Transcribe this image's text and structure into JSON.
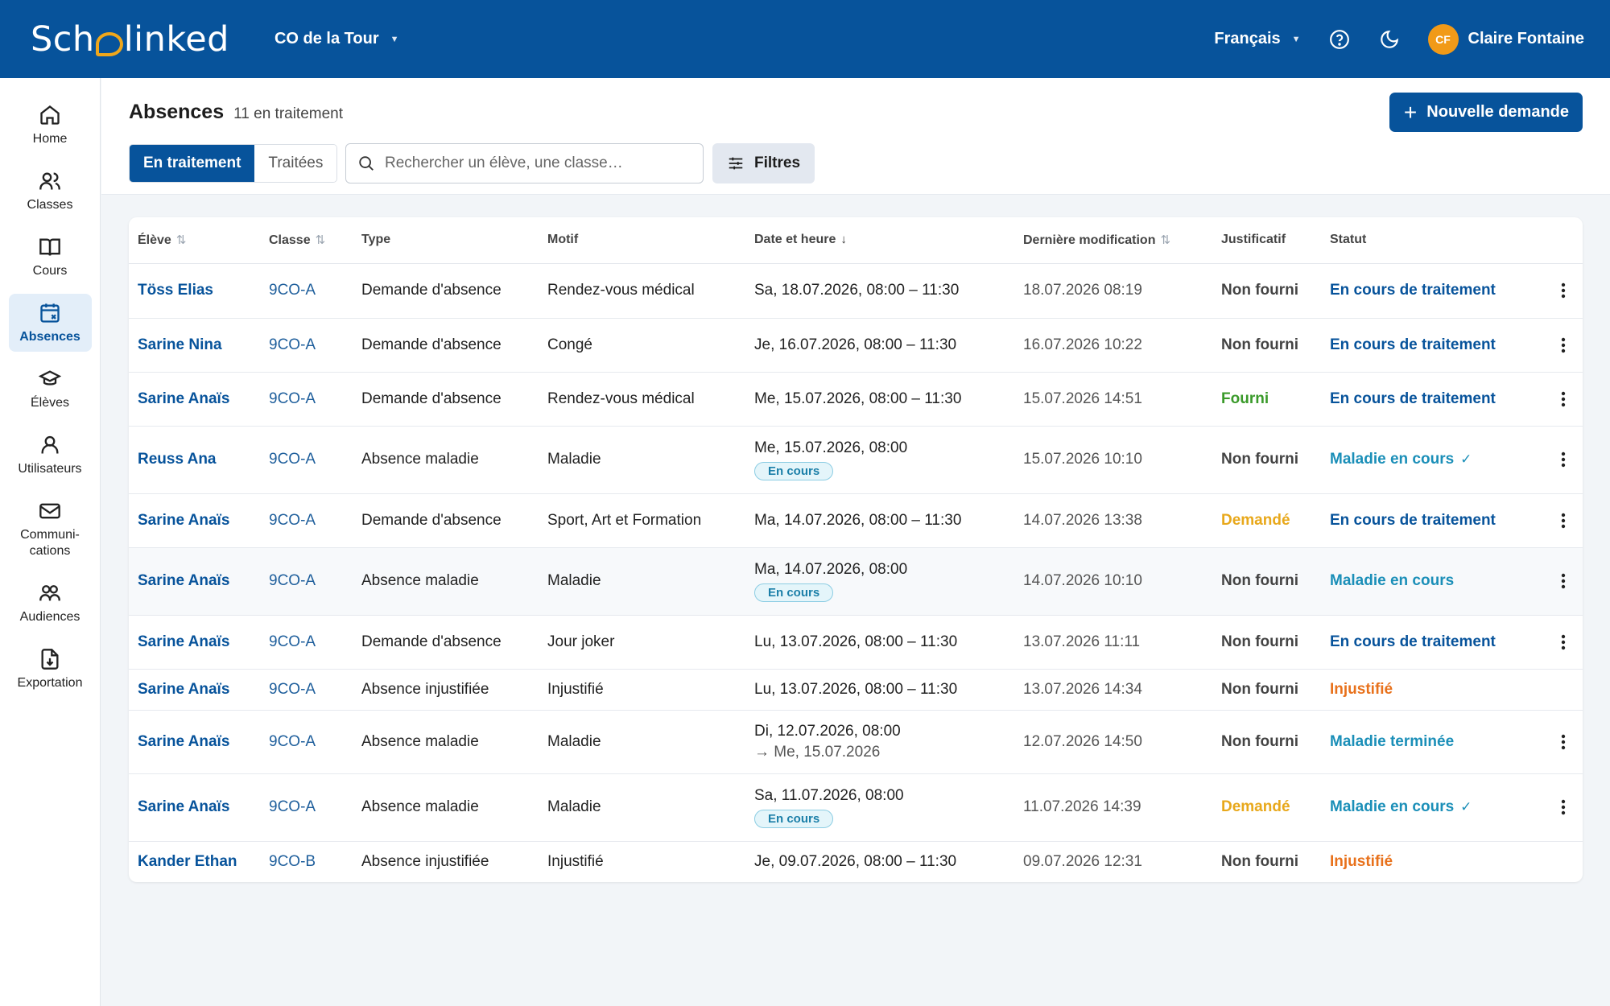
{
  "app": {
    "logo_text_a": "Sch",
    "logo_text_b": "linked",
    "school": "CO de la Tour",
    "language": "Français",
    "user_initials": "CF",
    "user_name": "Claire Fontaine"
  },
  "sidebar": {
    "items": [
      {
        "label": "Home",
        "icon": "home-icon"
      },
      {
        "label": "Classes",
        "icon": "users-icon"
      },
      {
        "label": "Cours",
        "icon": "book-icon"
      },
      {
        "label": "Absences",
        "icon": "calendar-x-icon",
        "active": true
      },
      {
        "label": "Élèves",
        "icon": "graduation-cap-icon"
      },
      {
        "label": "Utilisateurs",
        "icon": "user-icon"
      },
      {
        "label": "Communi-\ncations",
        "icon": "mail-icon"
      },
      {
        "label": "Audiences",
        "icon": "audience-icon"
      },
      {
        "label": "Exportation",
        "icon": "export-icon"
      }
    ]
  },
  "header": {
    "title": "Absences",
    "count": "11 en traitement",
    "new_button": "Nouvelle demande",
    "tabs": [
      "En traitement",
      "Traitées"
    ],
    "search_placeholder": "Rechercher un élève, une classe…",
    "filters": "Filtres"
  },
  "table": {
    "columns": [
      "Élève",
      "Classe",
      "Type",
      "Motif",
      "Date et heure",
      "Dernière modification",
      "Justificatif",
      "Statut"
    ],
    "rows": [
      {
        "eleve": "Töss Elias",
        "classe": "9CO-A",
        "type": "Demande d'absence",
        "motif": "Rendez-vous médical",
        "date": "Sa, 18.07.2026, 08:00 – 11:30",
        "modif": "18.07.2026 08:19",
        "justificatif": "Non fourni",
        "statut": "En cours de traitement"
      },
      {
        "eleve": "Sarine Nina",
        "classe": "9CO-A",
        "type": "Demande d'absence",
        "motif": "Congé",
        "date": "Je, 16.07.2026, 08:00 – 11:30",
        "modif": "16.07.2026 10:22",
        "justificatif": "Non fourni",
        "statut": "En cours de traitement"
      },
      {
        "eleve": "Sarine Anaïs",
        "classe": "9CO-A",
        "type": "Demande d'absence",
        "motif": "Rendez-vous médical",
        "date": "Me, 15.07.2026, 08:00 – 11:30",
        "modif": "15.07.2026 14:51",
        "justificatif": "Fourni",
        "statut": "En cours de traitement"
      },
      {
        "eleve": "Reuss Ana",
        "classe": "9CO-A",
        "type": "Absence maladie",
        "motif": "Maladie",
        "date": "Me, 15.07.2026, 08:00",
        "badge": "En cours",
        "modif": "15.07.2026 10:10",
        "justificatif": "Non fourni",
        "statut": "Maladie en cours",
        "check": "✓"
      },
      {
        "eleve": "Sarine Anaïs",
        "classe": "9CO-A",
        "type": "Demande d'absence",
        "motif": "Sport, Art et Formation",
        "date": "Ma, 14.07.2026, 08:00 – 11:30",
        "modif": "14.07.2026 13:38",
        "justificatif": "Demandé",
        "statut": "En cours de traitement"
      },
      {
        "eleve": "Sarine Anaïs",
        "classe": "9CO-A",
        "type": "Absence maladie",
        "motif": "Maladie",
        "date": "Ma, 14.07.2026, 08:00",
        "badge": "En cours",
        "modif": "14.07.2026 10:10",
        "justificatif": "Non fourni",
        "statut": "Maladie en cours",
        "alt": true
      },
      {
        "eleve": "Sarine Anaïs",
        "classe": "9CO-A",
        "type": "Demande d'absence",
        "motif": "Jour joker",
        "date": "Lu, 13.07.2026, 08:00 – 11:30",
        "modif": "13.07.2026 11:11",
        "justificatif": "Non fourni",
        "statut": "En cours de traitement"
      },
      {
        "eleve": "Sarine Anaïs",
        "classe": "9CO-A",
        "type": "Absence injustifiée",
        "motif": "Injustifié",
        "date": "Lu, 13.07.2026, 08:00 – 11:30",
        "modif": "13.07.2026 14:34",
        "justificatif": "Non fourni",
        "statut": "Injustifié",
        "no_menu": true
      },
      {
        "eleve": "Sarine Anaïs",
        "classe": "9CO-A",
        "type": "Absence maladie",
        "motif": "Maladie",
        "date": "Di, 12.07.2026, 08:00",
        "date_end": "→ Me, 15.07.2026",
        "modif": "12.07.2026 14:50",
        "justificatif": "Non fourni",
        "statut": "Maladie terminée"
      },
      {
        "eleve": "Sarine Anaïs",
        "classe": "9CO-A",
        "type": "Absence maladie",
        "motif": "Maladie",
        "date": "Sa, 11.07.2026, 08:00",
        "badge": "En cours",
        "modif": "11.07.2026 14:39",
        "justificatif": "Demandé",
        "statut": "Maladie en cours",
        "check": "✓"
      },
      {
        "eleve": "Kander Ethan",
        "classe": "9CO-B",
        "type": "Absence injustifiée",
        "motif": "Injustifié",
        "date": "Je, 09.07.2026, 08:00 – 11:30",
        "modif": "09.07.2026 12:31",
        "justificatif": "Non fourni",
        "statut": "Injustifié",
        "no_menu": true
      }
    ]
  },
  "colors": {
    "brand": "#07539b",
    "status_traitement": "#07539b",
    "status_maladie": "#1b8fb8",
    "status_injustifie": "#e8711b",
    "just_fourni": "#3a9a2a",
    "just_demande": "#e8a81b",
    "just_non_fourni": "#444444"
  }
}
